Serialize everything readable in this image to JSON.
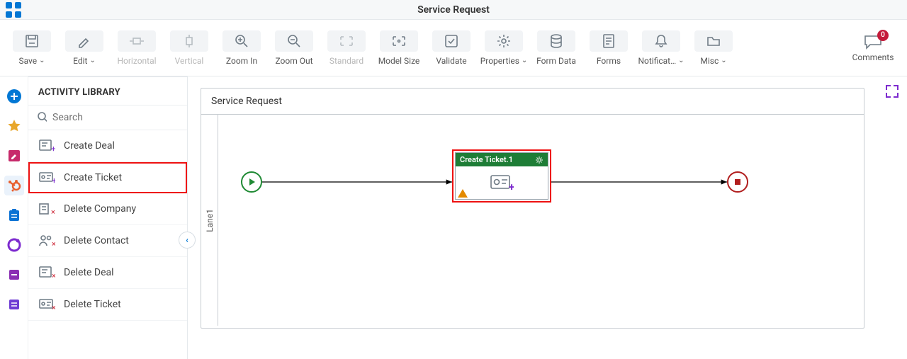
{
  "header": {
    "title": "Service Request"
  },
  "toolbar": {
    "save": "Save",
    "edit": "Edit",
    "horizontal": "Horizontal",
    "vertical": "Vertical",
    "zoom_in": "Zoom In",
    "zoom_out": "Zoom Out",
    "standard": "Standard",
    "model_size": "Model Size",
    "validate": "Validate",
    "properties": "Properties",
    "form_data": "Form Data",
    "forms": "Forms",
    "notifications": "Notificat…",
    "misc": "Misc",
    "comments": "Comments",
    "comments_count": "0"
  },
  "library": {
    "title": "ACTIVITY LIBRARY",
    "search_placeholder": "Search",
    "items": [
      "Create Deal",
      "Create Ticket",
      "Delete Company",
      "Delete Contact",
      "Delete Deal",
      "Delete Ticket"
    ]
  },
  "canvas": {
    "title": "Service Request",
    "lane": "Lane1",
    "task_label": "Create Ticket.1"
  }
}
